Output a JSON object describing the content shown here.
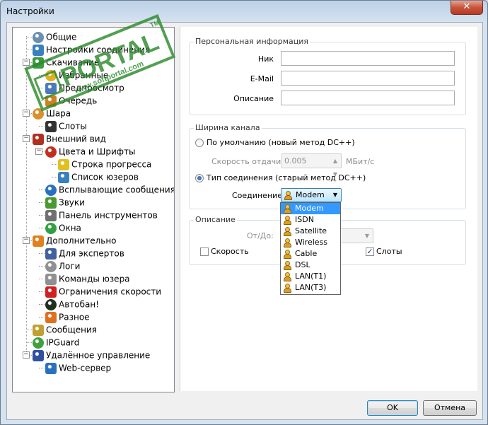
{
  "window": {
    "title": "Настройки",
    "close_glyph": "✕"
  },
  "tree": {
    "items": [
      {
        "label": "Общие",
        "icon": "users-icon",
        "color": "#6a8fb0"
      },
      {
        "label": "Настройки соединения",
        "icon": "globe-icon",
        "color": "#3a7fc0"
      },
      {
        "label": "Скачивание",
        "icon": "download-globe-icon",
        "color": "#3a9a40"
      },
      {
        "label": "Избранные",
        "icon": "star-folder-icon",
        "color": "#e0b020"
      },
      {
        "label": "Предпросмотр",
        "icon": "preview-icon",
        "color": "#4a7ab8"
      },
      {
        "label": "Очередь",
        "icon": "queue-icon",
        "color": "#d08020"
      },
      {
        "label": "Шара",
        "icon": "share-box-icon",
        "color": "#d89030"
      },
      {
        "label": "Слоты",
        "icon": "bar-chart-icon",
        "color": "#333333"
      },
      {
        "label": "Внешний вид",
        "icon": "appearance-icon",
        "color": "#b03020"
      },
      {
        "label": "Цвета и Шрифты",
        "icon": "palette-icon",
        "color": "#c03020"
      },
      {
        "label": "Строка прогресса",
        "icon": "progress-flag-icon",
        "color": "#e0c020"
      },
      {
        "label": "Список юзеров",
        "icon": "userlist-icon",
        "color": "#3a80c0"
      },
      {
        "label": "Всплывающие сообщения",
        "icon": "popup-icon",
        "color": "#2a70c0"
      },
      {
        "label": "Звуки",
        "icon": "music-note-icon",
        "color": "#4a9a30"
      },
      {
        "label": "Панель инструментов",
        "icon": "hammer-icon",
        "color": "#707070"
      },
      {
        "label": "Окна",
        "icon": "windows-icon",
        "color": "#30a040"
      },
      {
        "label": "Дополнительно",
        "icon": "advanced-icon",
        "color": "#e08020"
      },
      {
        "label": "Для экспертов",
        "icon": "expert-icon",
        "color": "#4060a0"
      },
      {
        "label": "Логи",
        "icon": "log-pen-icon",
        "color": "#909090"
      },
      {
        "label": "Команды юзера",
        "icon": "commands-icon",
        "color": "#909090"
      },
      {
        "label": "Ограничения скорости",
        "icon": "speed-limit-icon",
        "color": "#d02020"
      },
      {
        "label": "Автобан!",
        "icon": "autoban-icon",
        "color": "#203020"
      },
      {
        "label": "Разное",
        "icon": "misc-cube-icon",
        "color": "#e07020"
      },
      {
        "label": "Сообщения",
        "icon": "messages-icon",
        "color": "#c0a030"
      },
      {
        "label": "IPGuard",
        "icon": "ipguard-icon",
        "color": "#40a040"
      },
      {
        "label": "Удалённое управление",
        "icon": "remote-control-icon",
        "color": "#3050a0"
      },
      {
        "label": "Web-сервер",
        "icon": "web-server-icon",
        "color": "#2a70c0"
      }
    ]
  },
  "personal": {
    "group_title": "Персональная информация",
    "nick_label": "Ник",
    "nick_value": "",
    "email_label": "E-Mail",
    "email_value": "",
    "desc_label": "Описание",
    "desc_value": ""
  },
  "bandwidth": {
    "group_title": "Ширина канала",
    "default_radio_label": "По умолчанию (новый метод DC++)",
    "upload_speed_label": "Скорость отдачи",
    "upload_speed_value": "0.005",
    "upload_unit": "МБит/с",
    "type_radio_label": "Тип соединения (старый метод DC++)",
    "connection_label": "Соединение",
    "connection_value": "Modem",
    "selected_option": "type"
  },
  "connection_options": [
    "Modem",
    "ISDN",
    "Satellite",
    "Wireless",
    "Cable",
    "DSL",
    "LAN(T1)",
    "LAN(T3)"
  ],
  "description": {
    "group_title": "Описание",
    "from_to_label": "От/До:",
    "speed_check_label": "Скорость",
    "speed_checked": false,
    "slots_check_label": "Слоты",
    "slots_checked": true
  },
  "buttons": {
    "ok": "OK",
    "cancel": "Отмена"
  },
  "watermark": {
    "brand": "PORTAL",
    "site": "www.softportal.com",
    "tm": "TM"
  }
}
